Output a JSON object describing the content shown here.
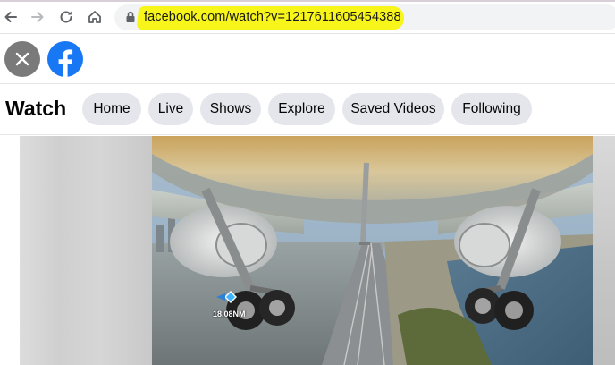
{
  "browser": {
    "url": "facebook.com/watch?v=1217611605454388",
    "icons": [
      "back-icon",
      "forward-icon",
      "reload-icon",
      "home-icon",
      "lock-icon"
    ]
  },
  "header": {
    "close_icon": "close-icon",
    "logo": "facebook-logo"
  },
  "watch": {
    "title": "Watch",
    "tabs": [
      {
        "label": "Home"
      },
      {
        "label": "Live"
      },
      {
        "label": "Shows"
      },
      {
        "label": "Explore"
      },
      {
        "label": "Saved Videos"
      },
      {
        "label": "Following"
      }
    ]
  },
  "video": {
    "hud_distance": "18.08NM"
  },
  "colors": {
    "facebook_blue": "#1877f2",
    "pill_bg": "#e4e6eb",
    "highlight_yellow": "#f7f51a"
  }
}
